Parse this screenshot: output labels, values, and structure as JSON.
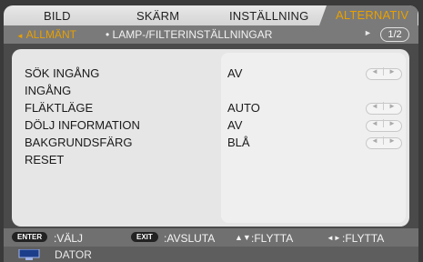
{
  "tabs": [
    "BILD",
    "SKÄRM",
    "INSTÄLLNING",
    "ALTERNATIV"
  ],
  "active_tab": "ALTERNATIV",
  "subnav": {
    "items": [
      "ALLMÄNT",
      "LAMP-/FILTERINSTÄLLNINGAR"
    ],
    "active": "ALLMÄNT",
    "page": "1/2"
  },
  "rows": [
    {
      "label": "SÖK INGÅNG",
      "value": "AV",
      "control": true
    },
    {
      "label": "INGÅNG",
      "value": "",
      "control": false
    },
    {
      "label": "FLÄKTLÄGE",
      "value": "AUTO",
      "control": true
    },
    {
      "label": "DÖLJ INFORMATION",
      "value": "AV",
      "control": true
    },
    {
      "label": "BAKGRUNDSFÄRG",
      "value": "BLÅ",
      "control": true
    },
    {
      "label": "RESET",
      "value": "",
      "control": false
    }
  ],
  "footer": {
    "enter_badge": "ENTER",
    "select": ":VÄLJ",
    "exit_badge": "EXIT",
    "exit": ":AVSLUTA",
    "move_vertical": ":FLYTTA",
    "move_horizontal": ":FLYTTA"
  },
  "source": "DATOR",
  "colors": {
    "accent": "#e8a000",
    "tab_bar": "#d4d4d4",
    "active_tab_bg": "#7a7a7a",
    "panel": "#e6e6e6",
    "footer": "#707070"
  }
}
